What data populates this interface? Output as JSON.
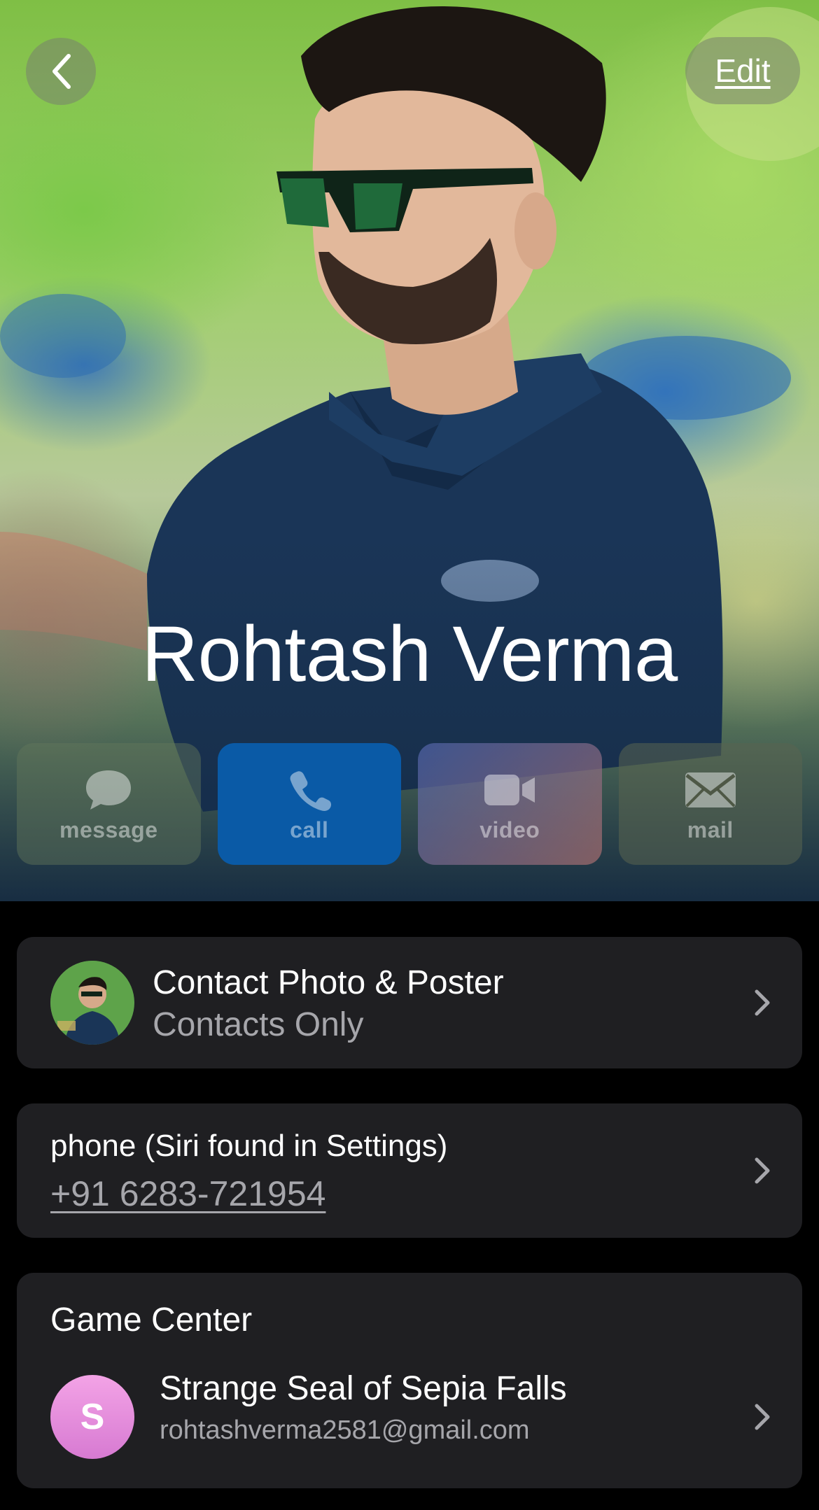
{
  "header": {
    "back_icon": "chevron-left-icon",
    "edit_label": "Edit"
  },
  "contact": {
    "name": "Rohtash Verma"
  },
  "actions": [
    {
      "label": "message",
      "icon": "message-bubble-icon"
    },
    {
      "label": "call",
      "icon": "phone-icon"
    },
    {
      "label": "video",
      "icon": "video-camera-icon"
    },
    {
      "label": "mail",
      "icon": "envelope-icon"
    }
  ],
  "photo_poster": {
    "title": "Contact Photo & Poster",
    "subtitle": "Contacts Only"
  },
  "phone": {
    "label": "phone (Siri found in Settings)",
    "number": "+91 6283-721954"
  },
  "game_center": {
    "title": "Game Center",
    "avatar_letter": "S",
    "player_name": "Strange Seal of Sepia Falls",
    "email": "rohtashverma2581@gmail.com"
  },
  "colors": {
    "call_button": "#0a5aa6",
    "card_background": "#1f1f22",
    "secondary_text": "#a6a6ab",
    "game_center_avatar": "#e08ad9"
  }
}
